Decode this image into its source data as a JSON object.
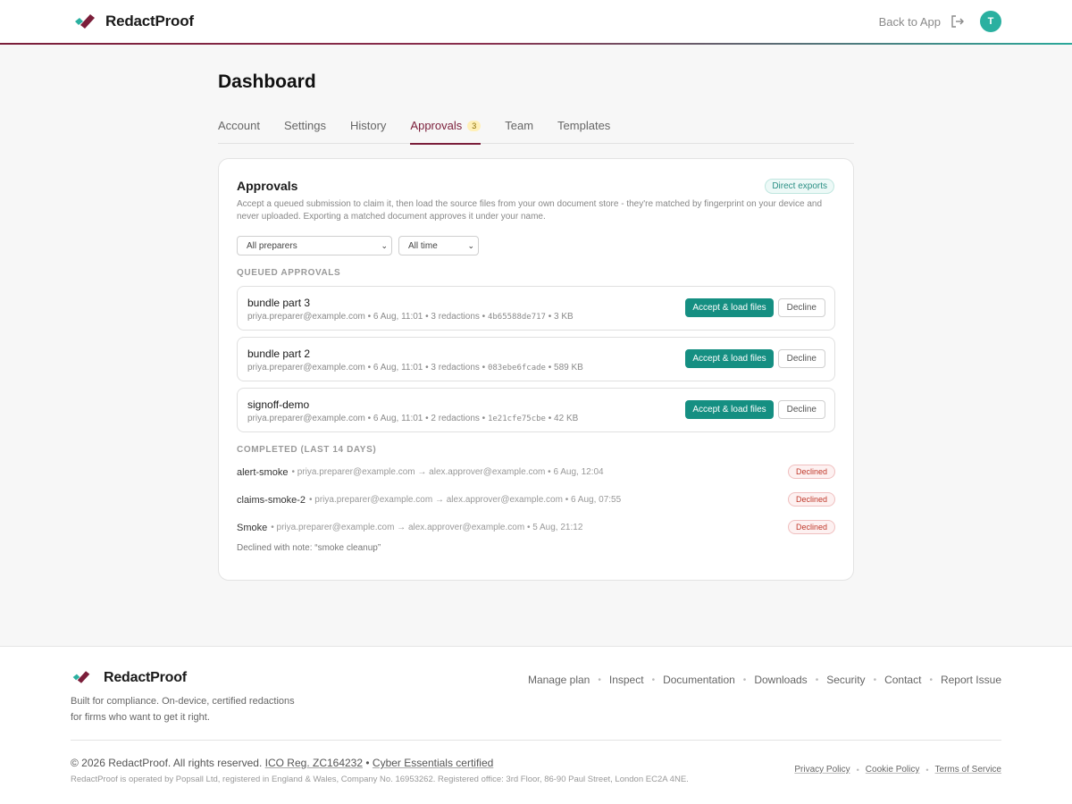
{
  "header": {
    "brand": "RedactProof",
    "back_link": "Back to App",
    "avatar_initial": "T"
  },
  "page": {
    "title": "Dashboard",
    "tabs": [
      {
        "label": "Account"
      },
      {
        "label": "Settings"
      },
      {
        "label": "History"
      },
      {
        "label": "Approvals",
        "badge": "3",
        "active": true
      },
      {
        "label": "Team"
      },
      {
        "label": "Templates"
      }
    ]
  },
  "approvals": {
    "title": "Approvals",
    "badge": "Direct exports",
    "description": "Accept a queued submission to claim it, then load the source files from your own document store - they're matched by fingerprint on your device and never uploaded. Exporting a matched document approves it under your name.",
    "filters": {
      "preparer": "All preparers",
      "time": "All time"
    },
    "queued_label": "QUEUED APPROVALS",
    "accept_label": "Accept & load files",
    "decline_label": "Decline",
    "queued": [
      {
        "name": "bundle part 3",
        "meta": "priya.preparer@example.com • 6 Aug, 11:01 • 3 redactions •",
        "hash": "4b65588de717",
        "size": "• 3 KB"
      },
      {
        "name": "bundle part 2",
        "meta": "priya.preparer@example.com • 6 Aug, 11:01 • 3 redactions •",
        "hash": "083ebe6fcade",
        "size": "• 589 KB"
      },
      {
        "name": "signoff-demo",
        "meta": "priya.preparer@example.com • 6 Aug, 11:01 • 2 redactions •",
        "hash": "1e21cfe75cbe",
        "size": "• 42 KB"
      }
    ],
    "completed_label": "COMPLETED (LAST 14 DAYS)",
    "completed": [
      {
        "name": "alert-smoke",
        "meta": "• priya.preparer@example.com → alex.approver@example.com • 6 Aug, 12:04",
        "status": "Declined"
      },
      {
        "name": "claims-smoke-2",
        "meta": "• priya.preparer@example.com → alex.approver@example.com • 6 Aug, 07:55",
        "status": "Declined"
      },
      {
        "name": "Smoke",
        "meta": "• priya.preparer@example.com → alex.approver@example.com • 5 Aug, 21:12",
        "status": "Declined"
      }
    ],
    "decline_note": "Declined with note: “smoke cleanup”"
  },
  "footer": {
    "brand": "RedactProof",
    "tagline_1": "Built for compliance. On-device, certified redactions",
    "tagline_2": "for firms who want to get it right.",
    "links": [
      "Manage plan",
      "Inspect",
      "Documentation",
      "Downloads",
      "Security",
      "Contact",
      "Report Issue"
    ],
    "copyright": "© 2026 RedactProof. All rights reserved.",
    "ico": "ICO Reg. ZC164232",
    "cyber": "Cyber Essentials certified",
    "legal": "RedactProof is operated by Popsall Ltd, registered in England & Wales, Company No. 16953262. Registered office: 3rd Floor, 86-90 Paul Street, London EC2A 4NE.",
    "bottom_links": [
      "Privacy Policy",
      "Cookie Policy",
      "Terms of Service"
    ]
  },
  "colors": {
    "brand_maroon": "#7b1e3a",
    "accent_teal": "#158f82",
    "avatar_teal": "#2ab0a0",
    "declined_red": "#c0392b"
  },
  "icons": {
    "logo": "redactproof-logo",
    "exit": "exit-icon",
    "chevron": "chevron-down-icon"
  }
}
